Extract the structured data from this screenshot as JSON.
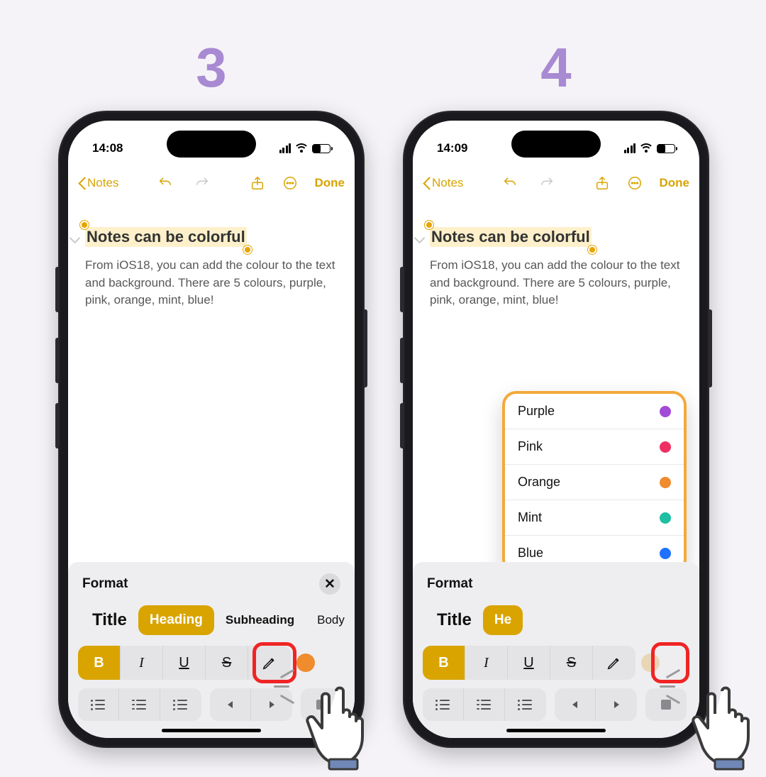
{
  "accent": "#d8a400",
  "steps": {
    "left": "3",
    "right": "4"
  },
  "phones": [
    {
      "status_time": "14:08",
      "nav": {
        "back": "Notes",
        "done": "Done"
      },
      "note": {
        "title": "Notes can be colorful",
        "body": "From iOS18, you can add the colour to the text and background. There are 5 colours, purple, pink, orange, mint, blue!"
      },
      "format": {
        "label": "Format",
        "styles": {
          "title": "Title",
          "heading": "Heading",
          "subheading": "Subheading",
          "body": "Body"
        },
        "bius": {
          "b": "B",
          "i": "I",
          "u": "U",
          "s": "S"
        },
        "swatch": "#f08b2e",
        "highlight": "pencil"
      }
    },
    {
      "status_time": "14:09",
      "nav": {
        "back": "Notes",
        "done": "Done"
      },
      "note": {
        "title": "Notes can be colorful",
        "body": "From iOS18, you can add the colour to the text and background. There are 5 colours, purple, pink, orange, mint, blue!"
      },
      "format": {
        "label": "Format",
        "styles": {
          "title": "Title",
          "heading": "He",
          "subheading": "",
          "body": ""
        },
        "bius": {
          "b": "B",
          "i": "I",
          "u": "U",
          "s": "S"
        },
        "swatch": "#e9d6b6",
        "highlight": "swatch"
      },
      "color_menu": [
        {
          "name": "Purple",
          "hex": "#a24bd8"
        },
        {
          "name": "Pink",
          "hex": "#ef2f62"
        },
        {
          "name": "Orange",
          "hex": "#f08b2e"
        },
        {
          "name": "Mint",
          "hex": "#1fbfa3"
        },
        {
          "name": "Blue",
          "hex": "#1f71ff"
        }
      ]
    }
  ]
}
